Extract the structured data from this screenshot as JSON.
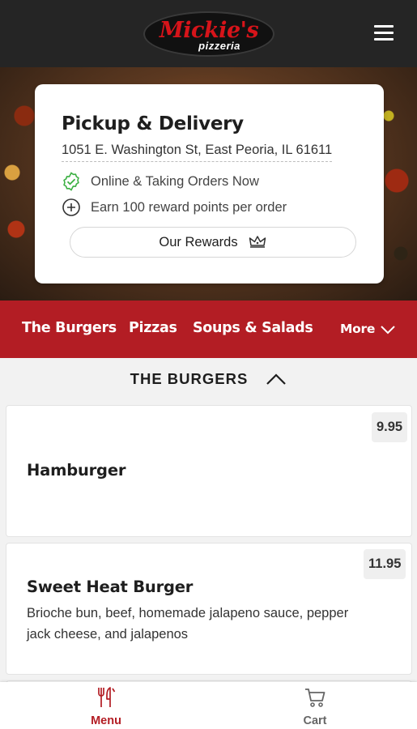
{
  "header": {
    "logo_main": "Mickie's",
    "logo_sub": "pizzeria",
    "menu_icon": "hamburger-menu-icon"
  },
  "card": {
    "title": "Pickup & Delivery",
    "address": "1051 E. Washington St, East Peoria, IL 61611",
    "status": "Online & Taking Orders Now",
    "rewards_info": "Earn 100 reward points per order",
    "rewards_button": "Our Rewards",
    "status_color": "#3cb043"
  },
  "categories": {
    "items": [
      "The Burgers",
      "Pizzas",
      "Soups & Salads"
    ],
    "more": "More"
  },
  "section": {
    "title": "THE BURGERS"
  },
  "menu_items": [
    {
      "name": "Hamburger",
      "description": "",
      "price": "9.95"
    },
    {
      "name": "Sweet Heat Burger",
      "description": "Brioche bun, beef, homemade jalapeno sauce, pepper jack cheese, and jalapenos",
      "price": "11.95"
    }
  ],
  "bottom_nav": {
    "menu_label": "Menu",
    "cart_label": "Cart",
    "active_color": "#b31d24",
    "inactive_color": "#666666"
  },
  "colors": {
    "brand_red": "#b31d24",
    "header_bg": "#252525"
  }
}
